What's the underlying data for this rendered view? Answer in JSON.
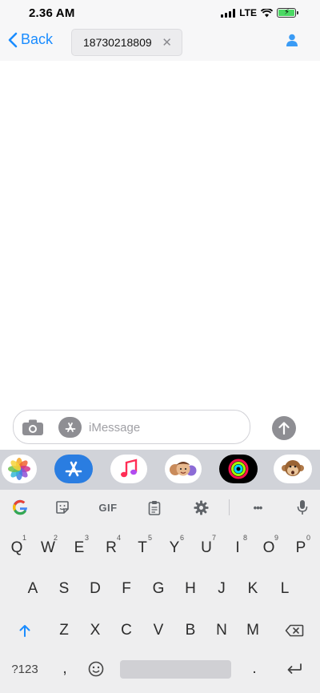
{
  "status_bar": {
    "time": "2.36 AM",
    "network": "LTE",
    "battery_level": 1.0,
    "battery_color": "#4cd964"
  },
  "nav": {
    "back_label": "Back",
    "recipient": "18730218809",
    "chip_close_glyph": "✕",
    "accent_color": "#1a8cff"
  },
  "composer": {
    "placeholder": "iMessage",
    "value": ""
  },
  "app_strip": {
    "apps": [
      "photos",
      "app-store",
      "music",
      "memoji",
      "activity",
      "animoji-monkey"
    ]
  },
  "keyboard": {
    "toolbar": {
      "gif_label": "GIF",
      "more_glyph": "•••"
    },
    "row1": [
      "Q",
      "W",
      "E",
      "R",
      "T",
      "Y",
      "U",
      "I",
      "O",
      "P"
    ],
    "row1_numbers": [
      "1",
      "2",
      "3",
      "4",
      "5",
      "6",
      "7",
      "8",
      "9",
      "0"
    ],
    "row2": [
      "A",
      "S",
      "D",
      "F",
      "G",
      "H",
      "J",
      "K",
      "L"
    ],
    "row3": [
      "Z",
      "X",
      "C",
      "V",
      "B",
      "N",
      "M"
    ],
    "symbols_label": "?123",
    "comma": ",",
    "period": "."
  }
}
